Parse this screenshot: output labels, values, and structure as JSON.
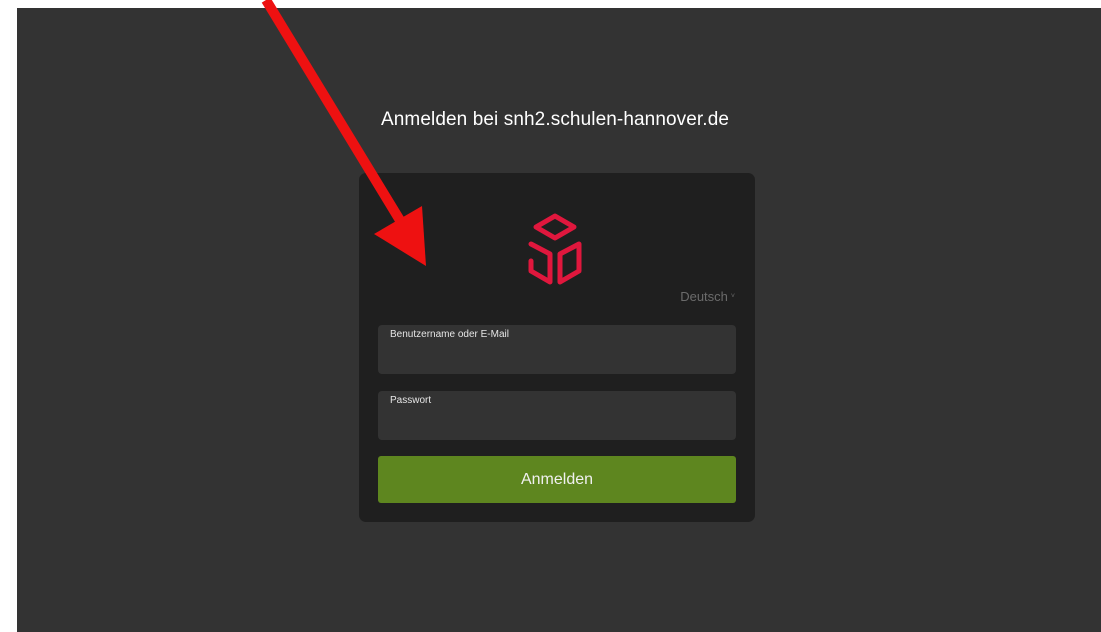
{
  "page": {
    "title": "Anmelden bei snh2.schulen-hannover.de"
  },
  "login": {
    "logo_icon": "cube-logo-icon",
    "language_selected": "Deutsch",
    "language_chevron": "˅",
    "username_label": "Benutzername oder E-Mail",
    "username_value": "",
    "password_label": "Passwort",
    "password_value": "",
    "submit_label": "Anmelden"
  },
  "overlay": {
    "arrow_icon": "red-arrow-annotation",
    "arrow_color": "#ee1111"
  },
  "colors": {
    "background": "#333333",
    "card": "#1f1f1f",
    "logo": "#e0173d",
    "button": "#5e861f"
  }
}
